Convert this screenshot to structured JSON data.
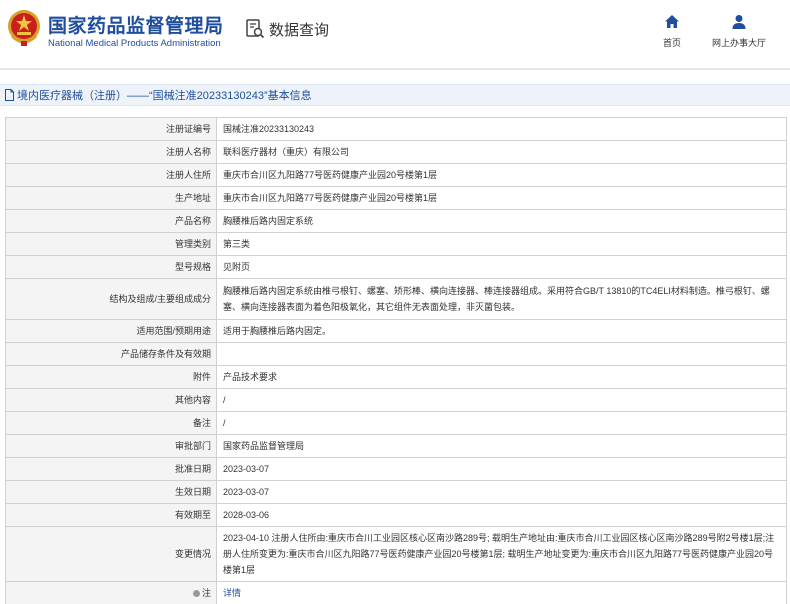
{
  "header": {
    "brand_cn": "国家药品监督管理局",
    "brand_en": "National Medical Products Administration",
    "module_label": "数据查询",
    "nav": [
      {
        "icon": "home-icon",
        "label": "首页"
      },
      {
        "icon": "user-icon",
        "label": "网上办事大厅"
      }
    ]
  },
  "breadcrumb": {
    "text": "境内医疗器械（注册）——“国械注准20233130243”基本信息"
  },
  "rows": [
    {
      "label": "注册证编号",
      "value": "国械注准20233130243"
    },
    {
      "label": "注册人名称",
      "value": "联科医疗器材（重庆）有限公司"
    },
    {
      "label": "注册人住所",
      "value": "重庆市合川区九阳路77号医药健康产业园20号楼第1层"
    },
    {
      "label": "生产地址",
      "value": "重庆市合川区九阳路77号医药健康产业园20号楼第1层"
    },
    {
      "label": "产品名称",
      "value": "胸腰椎后路内固定系统"
    },
    {
      "label": "管理类别",
      "value": "第三类"
    },
    {
      "label": "型号规格",
      "value": "见附页"
    },
    {
      "label": "结构及组成/主要组成成分",
      "value": "胸腰椎后路内固定系统由椎弓根钉、螺塞、矫形棒、横向连接器、棒连接器组成。采用符合GB/T 13810的TC4ELI材料制造。椎弓根钉、螺塞、横向连接器表面为着色阳极氧化，其它组件无表面处理，非灭菌包装。"
    },
    {
      "label": "适用范围/预期用途",
      "value": "适用于胸腰椎后路内固定。"
    },
    {
      "label": "产品储存条件及有效期",
      "value": ""
    },
    {
      "label": "附件",
      "value": "产品技术要求"
    },
    {
      "label": "其他内容",
      "value": "/"
    },
    {
      "label": "备注",
      "value": "/"
    },
    {
      "label": "审批部门",
      "value": "国家药品监督管理局"
    },
    {
      "label": "批准日期",
      "value": "2023-03-07"
    },
    {
      "label": "生效日期",
      "value": "2023-03-07"
    },
    {
      "label": "有效期至",
      "value": "2028-03-06"
    },
    {
      "label": "变更情况",
      "value": "2023-04-10 注册人住所由:重庆市合川工业园区核心区南沙路289号; 载明生产地址由:重庆市合川工业园区核心区南沙路289号附2号楼1层;注册人住所变更为:重庆市合川区九阳路77号医药健康产业园20号楼第1层; 载明生产地址变更为:重庆市合川区九阳路77号医药健康产业园20号楼第1层"
    }
  ],
  "note_row": {
    "label": "注",
    "link": "详情"
  },
  "colors": {
    "brand_blue": "#1f4e9e",
    "label_bg": "#f4f4f4",
    "border": "#d0d0d0",
    "crumb_bg": "#eef3fa"
  }
}
